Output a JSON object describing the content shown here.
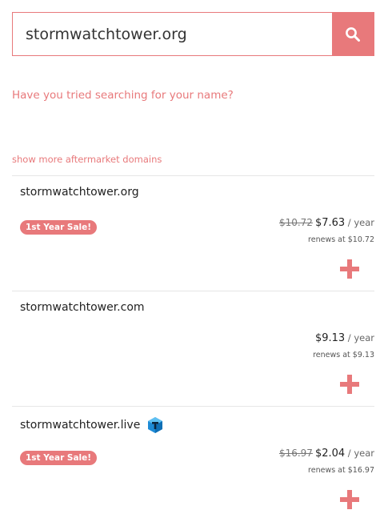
{
  "search": {
    "value": "stormwatchtower.org",
    "button_icon": "search-icon"
  },
  "links": {
    "name_prompt": "Have you tried searching for your name?",
    "show_more": "show more aftermarket domains"
  },
  "colors": {
    "accent": "#e8797b",
    "tld_badge": "#1e8bd6"
  },
  "results": [
    {
      "domain": "stormwatchtower.org",
      "badge": "1st Year Sale!",
      "old_price": "$10.72",
      "price": "$7.63",
      "per": " / year",
      "renews": "renews at $10.72",
      "add_icon": "plus-icon"
    },
    {
      "domain": "stormwatchtower.com",
      "price": "$9.13",
      "per": " / year",
      "renews": "renews at $9.13",
      "add_icon": "plus-icon"
    },
    {
      "domain": "stormwatchtower.live",
      "tld_icon": "registry-t-icon",
      "badge": "1st Year Sale!",
      "old_price": "$16.97",
      "price": "$2.04",
      "per": " / year",
      "renews": "renews at $16.97",
      "add_icon": "plus-icon"
    }
  ]
}
